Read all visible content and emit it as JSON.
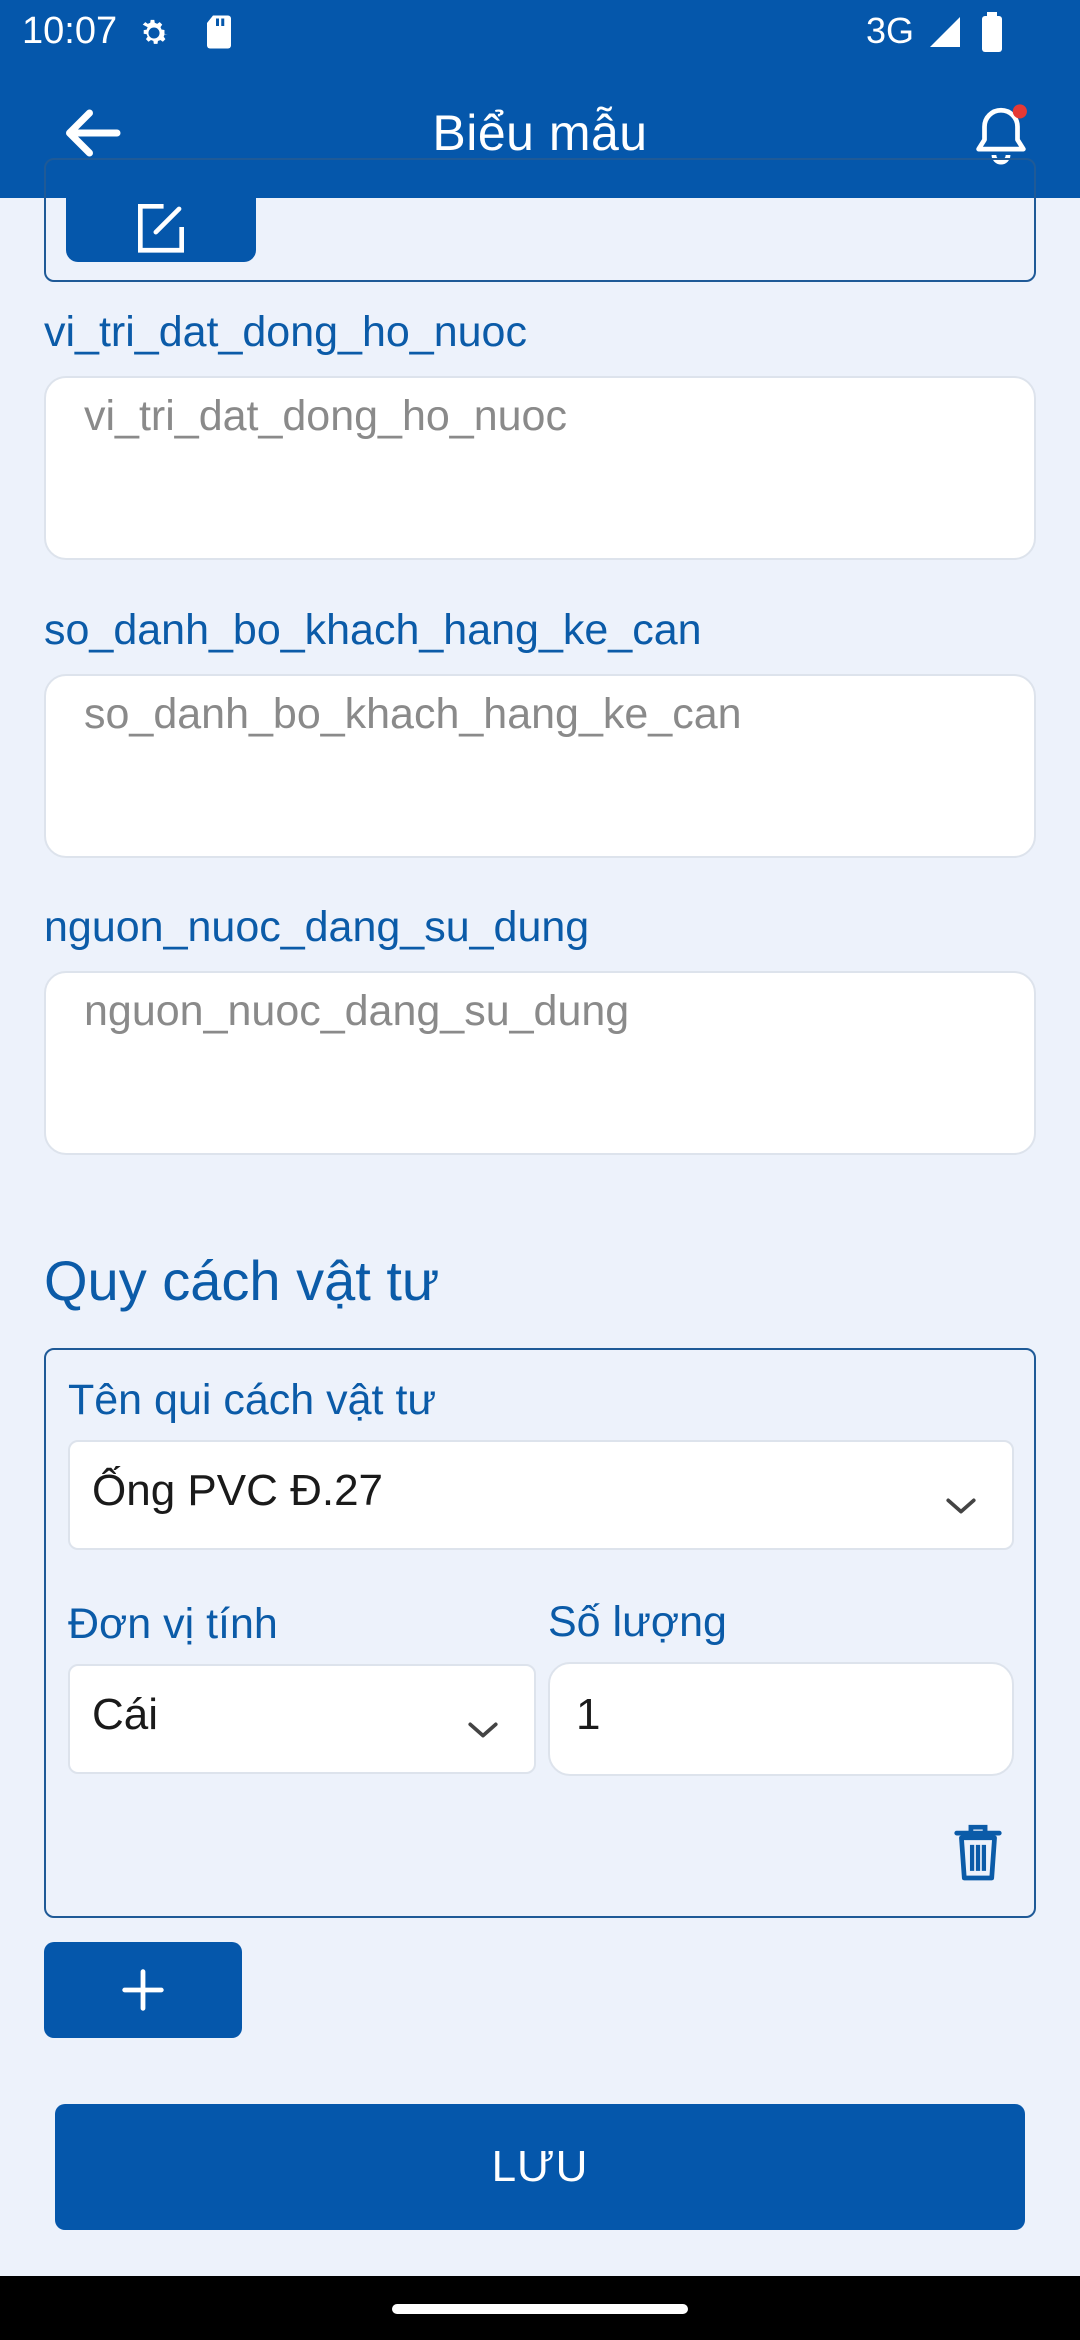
{
  "status_bar": {
    "time": "10:07",
    "network": "3G",
    "icons": [
      "settings-gear-icon",
      "sd-card-icon",
      "signal-icon",
      "battery-icon"
    ]
  },
  "app_bar": {
    "title": "Biểu mẫu",
    "back_icon": "arrow-left-icon",
    "notification_icon": "bell-icon",
    "notification_dot_color": "#E53935"
  },
  "fields": [
    {
      "label": "vi_tri_dat_dong_ho_nuoc",
      "placeholder": "vi_tri_dat_dong_ho_nuoc",
      "value": ""
    },
    {
      "label": "so_danh_bo_khach_hang_ke_can",
      "placeholder": "so_danh_bo_khach_hang_ke_can",
      "value": ""
    },
    {
      "label": "nguon_nuoc_dang_su_dung",
      "placeholder": "nguon_nuoc_dang_su_dung",
      "value": ""
    }
  ],
  "materials_section": {
    "title": "Quy cách vật tư",
    "items": [
      {
        "name_label": "Tên qui cách vật tư",
        "name_value": "Ống PVC Đ.27",
        "unit_label": "Đơn vị tính",
        "unit_value": "Cái",
        "quantity_label": "Số lượng",
        "quantity_value": "1"
      }
    ],
    "add_icon": "plus-icon",
    "delete_icon": "trash-icon"
  },
  "save_button": {
    "label": "LƯU"
  },
  "colors": {
    "primary": "#0557AB",
    "label": "#0B5BA8",
    "background": "#EDF2FB"
  }
}
